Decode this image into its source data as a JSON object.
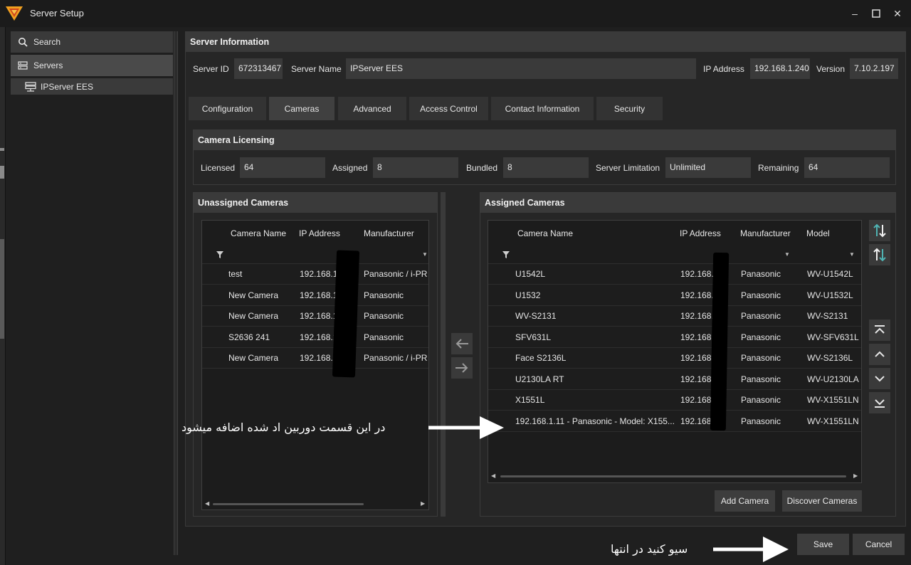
{
  "window": {
    "title": "Server Setup",
    "controls": [
      "minimize",
      "maximize",
      "close"
    ]
  },
  "sidebar": {
    "search_label": "Search",
    "servers_label": "Servers",
    "server_item": "IPServer EES"
  },
  "server_info": {
    "header": "Server Information",
    "server_id_label": "Server ID",
    "server_id": "672313467",
    "server_name_label": "Server Name",
    "server_name": "IPServer EES",
    "ip_label": "IP Address",
    "ip": "192.168.1.240",
    "version_label": "Version",
    "version": "7.10.2.197"
  },
  "tabs": [
    {
      "label": "Configuration",
      "active": false
    },
    {
      "label": "Cameras",
      "active": true
    },
    {
      "label": "Advanced",
      "active": false
    },
    {
      "label": "Access Control",
      "active": false
    },
    {
      "label": "Contact Information",
      "active": false
    },
    {
      "label": "Security",
      "active": false
    }
  ],
  "licensing": {
    "header": "Camera Licensing",
    "licensed_label": "Licensed",
    "licensed": "64",
    "assigned_label": "Assigned",
    "assigned": "8",
    "bundled_label": "Bundled",
    "bundled": "8",
    "limitation_label": "Server Limitation",
    "limitation": "Unlimited",
    "remaining_label": "Remaining",
    "remaining": "64"
  },
  "unassigned": {
    "header": "Unassigned Cameras",
    "columns": [
      "Camera Name",
      "IP Address",
      "Manufacturer"
    ],
    "rows": [
      [
        "test",
        "192.168.1.",
        "Panasonic / i-PRO"
      ],
      [
        "New Camera",
        "192.168.1.",
        "Panasonic"
      ],
      [
        "New Camera",
        "192.168.1.",
        "Panasonic"
      ],
      [
        "S2636 241",
        "192.168.1.",
        "Panasonic"
      ],
      [
        "New Camera",
        "192.168.1.",
        "Panasonic / i-PRO"
      ]
    ]
  },
  "assigned": {
    "header": "Assigned Cameras",
    "columns": [
      "Camera Name",
      "IP Address",
      "Manufacturer",
      "Model"
    ],
    "rows": [
      [
        "U1542L",
        "192.168.1.",
        "Panasonic",
        "WV-U1542L"
      ],
      [
        "U1532",
        "192.168.",
        "Panasonic",
        "WV-U1532L"
      ],
      [
        "WV-S2131",
        "192.168.",
        "Panasonic",
        "WV-S2131"
      ],
      [
        "SFV631L",
        "192.168.",
        "Panasonic",
        "WV-SFV631L"
      ],
      [
        "Face S2136L",
        "192.168.1",
        "Panasonic",
        "WV-S2136L"
      ],
      [
        "U2130LA RT",
        "192.168.",
        "Panasonic",
        "WV-U2130LA"
      ],
      [
        "X1551L",
        "192.168.",
        "Panasonic",
        "WV-X1551LN"
      ],
      [
        "192.168.1.11 - Panasonic - Model: X155...",
        "192.168.1",
        "Panasonic",
        "WV-X1551LN"
      ]
    ],
    "add_button": "Add Camera",
    "discover_button": "Discover Cameras"
  },
  "footer": {
    "save": "Save",
    "cancel": "Cancel"
  },
  "annotations": {
    "assigned_note": "در این قسمت دوربین اد شده اضافه میشود",
    "save_note": "سیو کنید در انتها"
  },
  "colors": {
    "accent_orange": "#f0a020",
    "teal_icon": "#4fb3b3",
    "panel_bg": "#262626",
    "field_bg": "#3a3a3a"
  }
}
